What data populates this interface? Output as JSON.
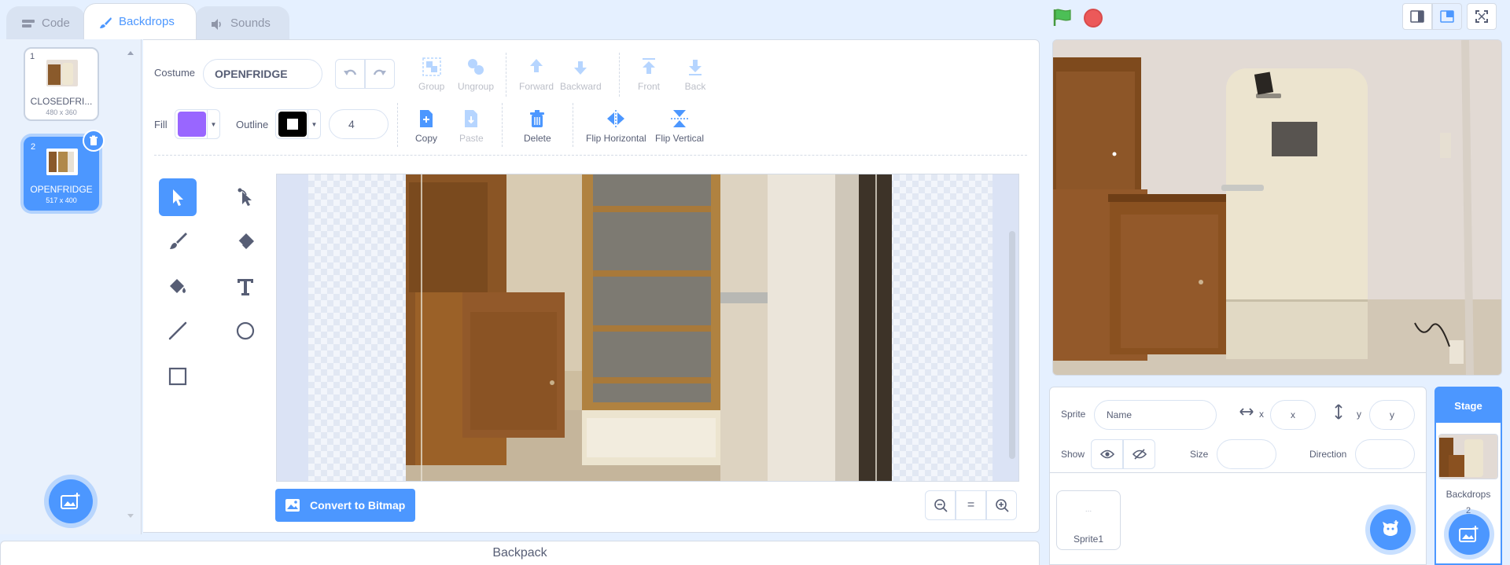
{
  "tabs": {
    "code": "Code",
    "backdrops": "Backdrops",
    "sounds": "Sounds"
  },
  "costumes": [
    {
      "number": "1",
      "name": "CLOSEDFRI...",
      "size": "480 x 360",
      "selected": false
    },
    {
      "number": "2",
      "name": "OPENFRIDGE",
      "size": "517 x 400",
      "selected": true
    }
  ],
  "editor": {
    "costume_label": "Costume",
    "costume_name": "OPENFRIDGE",
    "fill_label": "Fill",
    "fill_color": "#9966ff",
    "outline_label": "Outline",
    "outline_color": "#000000",
    "outline_width": "4",
    "toolbar": {
      "group": "Group",
      "ungroup": "Ungroup",
      "forward": "Forward",
      "backward": "Backward",
      "front": "Front",
      "back": "Back",
      "copy": "Copy",
      "paste": "Paste",
      "delete": "Delete",
      "flip_horizontal": "Flip Horizontal",
      "flip_vertical": "Flip Vertical"
    },
    "tools": [
      "select-icon",
      "reshape-icon",
      "brush-icon",
      "eraser-icon",
      "fill-icon",
      "text-icon",
      "line-icon",
      "circle-icon",
      "rectangle-icon"
    ],
    "convert_label": "Convert to Bitmap",
    "zoom_reset": "="
  },
  "backpack_label": "Backpack",
  "sprite_info": {
    "sprite_label": "Sprite",
    "name_placeholder": "Name",
    "x_label": "x",
    "x_placeholder": "x",
    "y_label": "y",
    "y_placeholder": "y",
    "show_label": "Show",
    "size_label": "Size",
    "direction_label": "Direction"
  },
  "sprites": [
    {
      "name": "Sprite1",
      "thumb": "..."
    }
  ],
  "stage_selector": {
    "title": "Stage",
    "backdrops_label": "Backdrops",
    "backdrop_count": "2"
  },
  "colors": {
    "accent": "#4c97ff",
    "stop": "#ec5959",
    "flag": "#4cbf56"
  }
}
